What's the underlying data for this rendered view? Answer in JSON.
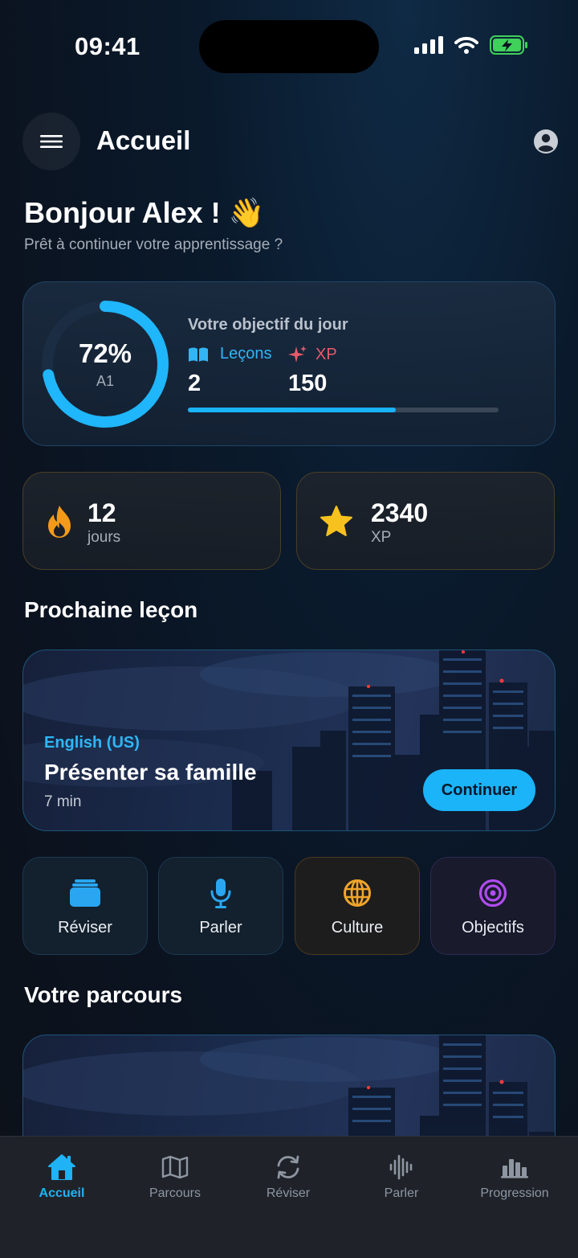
{
  "status_bar": {
    "time": "09:41"
  },
  "header": {
    "title": "Accueil"
  },
  "greeting": {
    "title": "Bonjour Alex ! 👋",
    "subtitle": "Prêt à continuer votre apprentissage ?"
  },
  "daily_goal": {
    "progress_percent": "72%",
    "progress_fraction": 0.72,
    "level": "A1",
    "title": "Votre objectif du jour",
    "lessons_label": "Leçons",
    "xp_label": "XP",
    "lessons_value": "2",
    "xp_value": "150",
    "bar_fraction": 0.67
  },
  "stats": {
    "streak_value": "12",
    "streak_unit": "jours",
    "xp_value": "2340",
    "xp_unit": "XP"
  },
  "next_lesson": {
    "section_title": "Prochaine leçon",
    "language": "English (US)",
    "title": "Présenter sa famille",
    "duration": "7 min",
    "button": "Continuer"
  },
  "quick_actions": [
    {
      "label": "Réviser",
      "icon": "cards-icon",
      "color": "#2aa6f0"
    },
    {
      "label": "Parler",
      "icon": "microphone-icon",
      "color": "#2aa6f0"
    },
    {
      "label": "Culture",
      "icon": "globe-icon",
      "color": "#f0a52a"
    },
    {
      "label": "Objectifs",
      "icon": "target-icon",
      "color": "#b04cf0"
    }
  ],
  "journey": {
    "section_title": "Votre parcours"
  },
  "tabs": [
    {
      "label": "Accueil",
      "icon": "home-icon",
      "active": true
    },
    {
      "label": "Parcours",
      "icon": "map-icon"
    },
    {
      "label": "Réviser",
      "icon": "refresh-icon"
    },
    {
      "label": "Parler",
      "icon": "soundwave-icon"
    },
    {
      "label": "Progression",
      "icon": "bar-chart-icon"
    }
  ],
  "colors": {
    "accent": "#1bb4f8",
    "xp": "#e85a6a",
    "streak": "#f5a623"
  }
}
